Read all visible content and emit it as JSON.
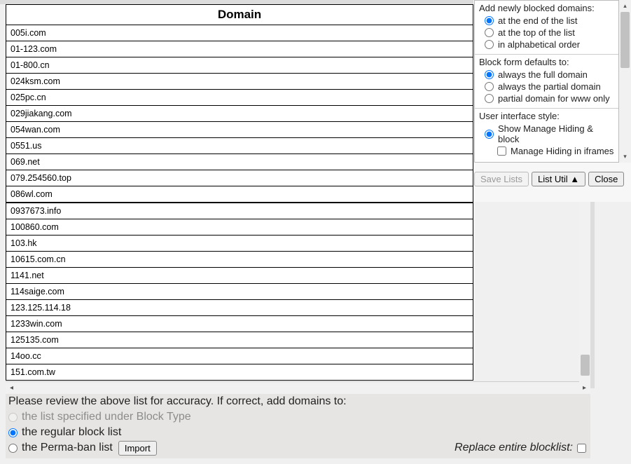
{
  "table": {
    "header": "Domain",
    "rows_wide": [
      "005i.com",
      "01-123.com",
      "01-800.cn",
      "024ksm.com",
      "025pc.cn",
      "029jiakang.com",
      "054wan.com",
      "0551.us",
      "069.net",
      "079.254560.top",
      "086wl.com"
    ],
    "rows_narrow": [
      "0937673.info",
      "100860.com",
      "103.hk",
      "10615.com.cn",
      "1141.net",
      "114saige.com",
      "123.125.114.18",
      "1233win.com",
      "125135.com",
      "14oo.cc",
      "151.com.tw"
    ]
  },
  "side": {
    "group1_title": "Add newly blocked domains:",
    "group1_opts": [
      "at the end of the list",
      "at the top of the list",
      "in alphabetical order"
    ],
    "group2_title": "Block form defaults to:",
    "group2_opts": [
      "always the full domain",
      "always the partial domain",
      "partial domain for www only"
    ],
    "group3_title": "User interface style:",
    "group3_opt": "Show Manage Hiding & block",
    "group3_chk": "Manage Hiding in iframes"
  },
  "buttons": {
    "save": "Save Lists",
    "util": "List Util ▲",
    "close": "Close"
  },
  "bottom": {
    "review": "Please review the above list for accuracy. If correct, add domains to:",
    "opt_disabled": "the list specified under Block Type",
    "opt_regular": "the regular block list",
    "opt_perma": "the Perma-ban list",
    "import": "Import",
    "replace": "Replace entire blocklist:"
  }
}
